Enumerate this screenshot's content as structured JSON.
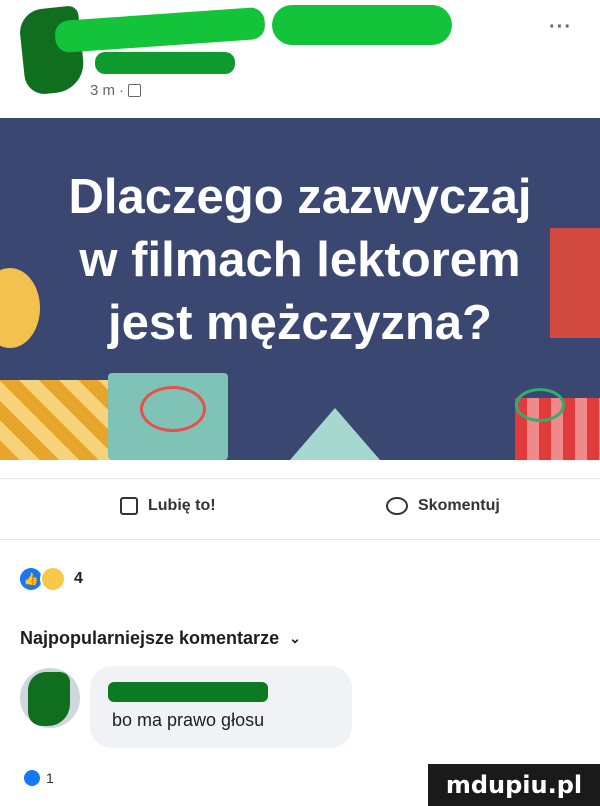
{
  "post": {
    "time": "3 m",
    "separator": "·",
    "more": "···",
    "image_title": [
      "Dlaczego zazwyczaj",
      "w filmach lektorem",
      "jest mężczyzna?"
    ]
  },
  "actions": {
    "like_label": "Lubię to!",
    "comment_label": "Skomentuj"
  },
  "reactions": {
    "icons": [
      "like-icon",
      "haha-icon"
    ],
    "count": "4"
  },
  "comments": {
    "section_title": "Najpopularniejsze komentarze",
    "items": [
      {
        "text": "bo ma prawo głosu",
        "reaction_count": "1"
      }
    ]
  },
  "watermark": "mdupiu.pl",
  "colors": {
    "image_bg": "#3a4770",
    "redaction": "#13c43a",
    "fb_blue": "#1877f2"
  }
}
